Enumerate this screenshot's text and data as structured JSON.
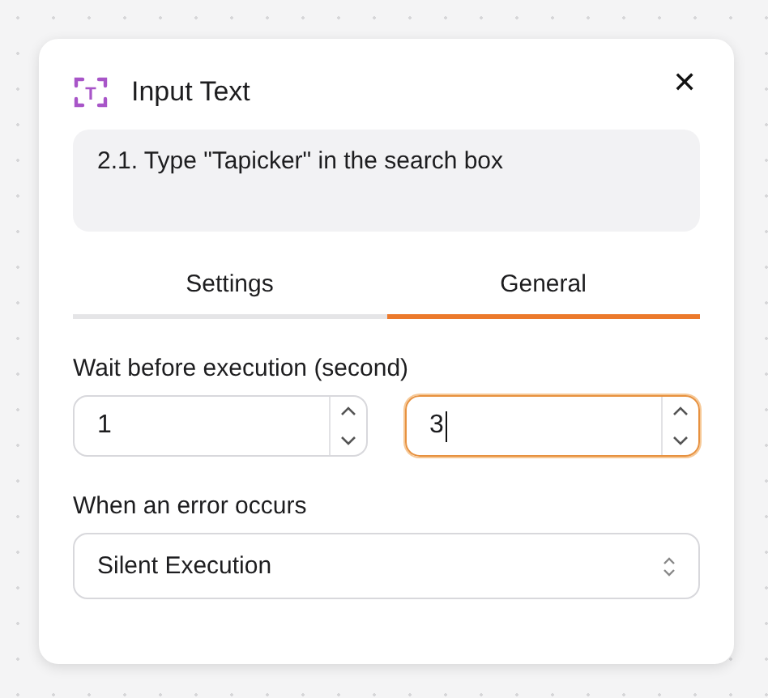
{
  "panel": {
    "icon_letter": "T",
    "title": "Input Text",
    "close": "✕",
    "description": "2.1. Type \"Tapicker\" in the search box"
  },
  "tabs": [
    {
      "label": "Settings",
      "selected": false
    },
    {
      "label": "General",
      "selected": true
    }
  ],
  "wait": {
    "label": "Wait before execution (second)",
    "fields": [
      {
        "value": "1",
        "focused": false
      },
      {
        "value": "3",
        "focused": true
      }
    ]
  },
  "error": {
    "label": "When an error occurs",
    "value": "Silent Execution"
  }
}
